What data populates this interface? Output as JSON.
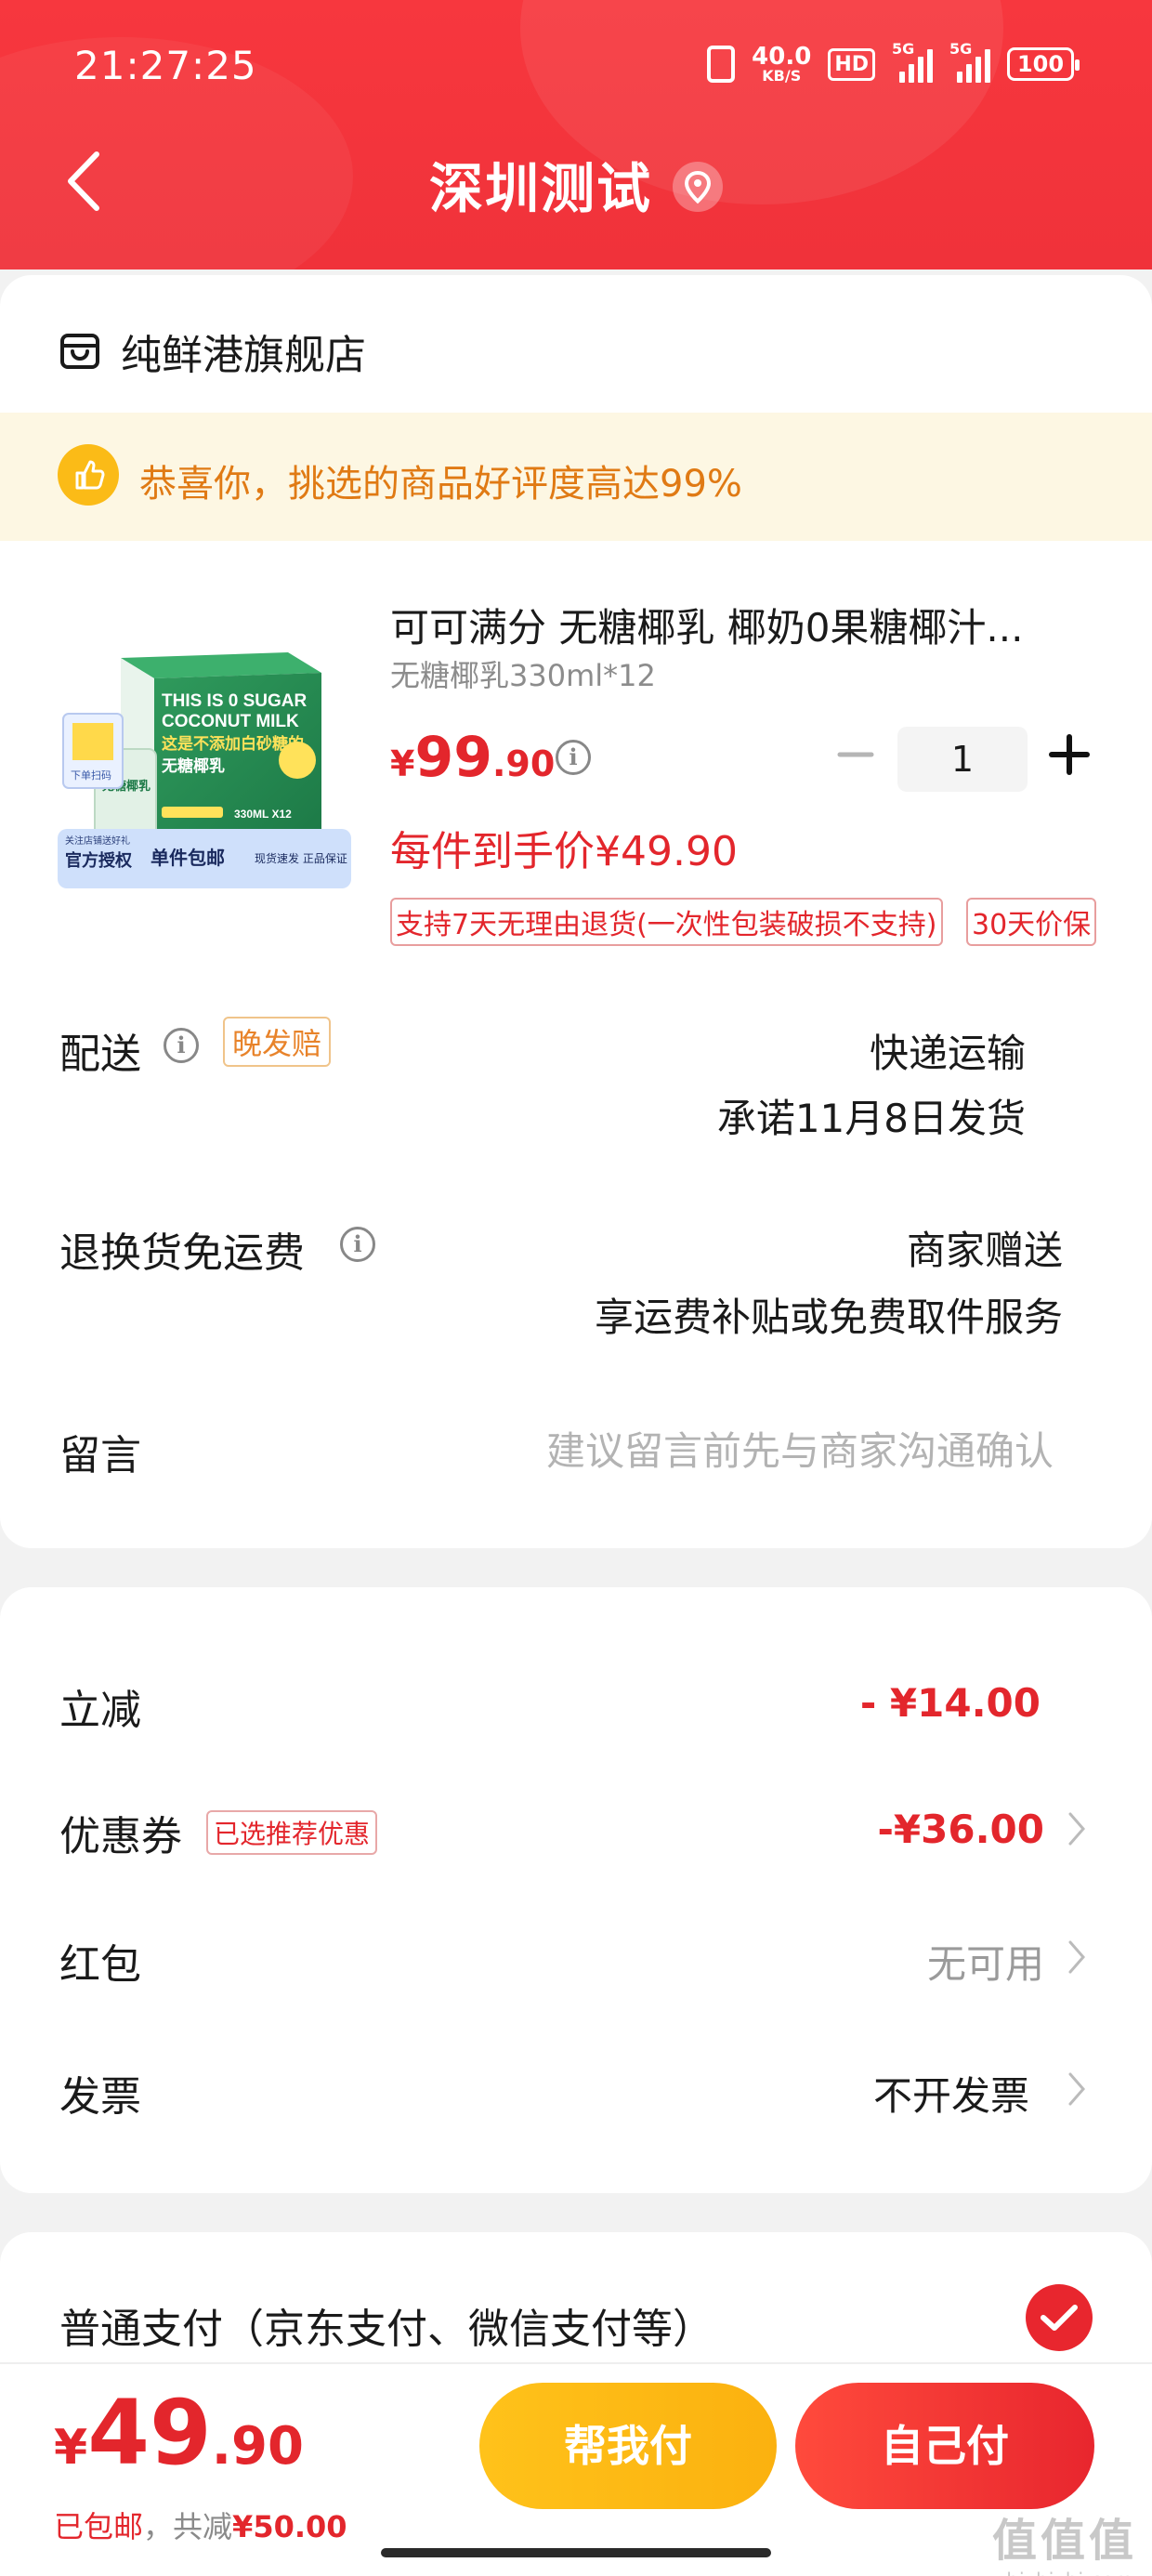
{
  "status_bar": {
    "time": "21:27:25",
    "net_speed": "40.0",
    "net_unit": "KB/S",
    "hd": "HD",
    "signal1": "5G",
    "signal2": "5G",
    "battery": "100"
  },
  "nav": {
    "title": "深圳测试",
    "back_icon": "chevron-left-icon",
    "location_icon": "location-pin-icon"
  },
  "store": {
    "icon": "store-icon",
    "name": "纯鲜港旗舰店"
  },
  "praise": {
    "icon": "thumbs-up-icon",
    "text": "恭喜你，挑选的商品好评度高达99%"
  },
  "product": {
    "title": "可可满分 无糖椰乳 椰奶0果糖椰汁...",
    "spec": "无糖椰乳330ml*12",
    "price_symbol": "¥",
    "price_int": "99",
    "price_dec": ".90",
    "quantity": "1",
    "final_price_text": "每件到手价¥49.90",
    "tag_return": "支持7天无理由退货(一次性包装破损不支持)",
    "tag_protect": "30天价保",
    "image": {
      "line1": "THIS IS 0 SUGAR",
      "line2": "COCONUT MILK",
      "line3": "这是不添加白砂糖的",
      "line4": "无糖椰乳",
      "volume": "330ML X12",
      "side_label": "无糖椰乳",
      "badge1": "官方授权",
      "badge2": "单件包邮",
      "badge3": "现货速发 正品保证",
      "corner_label": "关注店铺送好礼",
      "qr_label": "下单扫码"
    }
  },
  "delivery": {
    "label": "配送",
    "tag": "晚发赔",
    "method": "快递运输",
    "promise": "承诺11月8日发货"
  },
  "return_shipping": {
    "label": "退换货免运费",
    "value": "商家赠送",
    "desc": "享运费补贴或免费取件服务"
  },
  "message": {
    "label": "留言",
    "placeholder": "建议留言前先与商家沟通确认"
  },
  "discounts": {
    "instant": {
      "label": "立减",
      "value": "- ¥14.00"
    },
    "coupon": {
      "label": "优惠券",
      "tag": "已选推荐优惠",
      "value": "-¥36.00"
    },
    "red_packet": {
      "label": "红包",
      "value": "无可用"
    },
    "invoice": {
      "label": "发票",
      "value": "不开发票"
    }
  },
  "payment": {
    "label": "普通支付（京东支付、微信支付等）",
    "selected": true
  },
  "bottom": {
    "price_symbol": "¥",
    "price_int": "49",
    "price_dec": ".90",
    "shipping": "已包邮",
    "sep": "，",
    "saved_label": "共减",
    "saved_value": "¥50.00",
    "help_pay": "帮我付",
    "self_pay": "自己付"
  },
  "watermark": {
    "big": "值值值",
    "small": "zhizhizhi.com"
  },
  "colors": {
    "header_red": "#f0323a",
    "price_red": "#e3262c",
    "yellow_button": "#fbb10f",
    "praise_bg": "#fdf7e3",
    "praise_text": "#e07a14"
  }
}
